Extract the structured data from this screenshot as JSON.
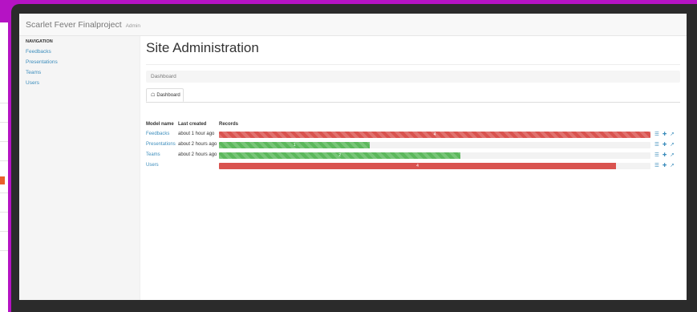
{
  "app": {
    "brand": "Scarlet Fever Finalproject",
    "brand_suffix": "Admin"
  },
  "sidebar": {
    "header": "NAVIGATION",
    "items": [
      {
        "label": "Feedbacks"
      },
      {
        "label": "Presentations"
      },
      {
        "label": "Teams"
      },
      {
        "label": "Users"
      }
    ]
  },
  "main": {
    "title": "Site Administration",
    "breadcrumb": "Dashboard",
    "tab": {
      "label": "Dashboard",
      "icon": "home-icon"
    }
  },
  "table": {
    "headers": {
      "model": "Model name",
      "created": "Last created",
      "records": "Records"
    },
    "rows": [
      {
        "name": "Feedbacks",
        "created": "about 1 hour ago",
        "count": "4",
        "fraction": 1.0,
        "color": "#d9534f",
        "striped": true
      },
      {
        "name": "Presentations",
        "created": "about 2 hours ago",
        "count": "1",
        "fraction": 0.35,
        "color": "#5cb85c",
        "striped": true
      },
      {
        "name": "Teams",
        "created": "about 2 hours ago",
        "count": "2",
        "fraction": 0.56,
        "color": "#5cb85c",
        "striped": true
      },
      {
        "name": "Users",
        "created": "",
        "count": "4",
        "fraction": 0.92,
        "color": "#d9534f",
        "striped": false
      }
    ],
    "action_icons": [
      "list-icon",
      "plus-icon",
      "external-link-icon"
    ]
  },
  "colors": {
    "link": "#3c8dbc",
    "danger": "#d9534f",
    "success": "#5cb85c",
    "frame_background": "#b513c4"
  }
}
